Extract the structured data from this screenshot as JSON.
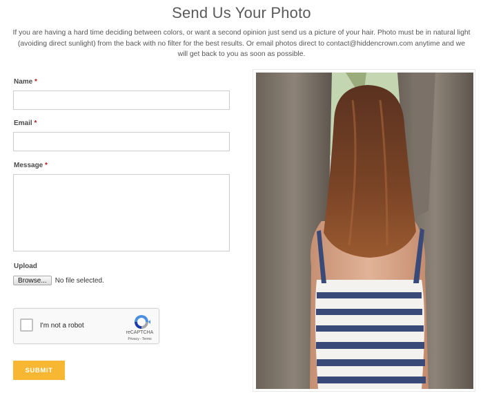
{
  "page": {
    "title": "Send Us Your Photo",
    "intro": "If you are having a hard time deciding between colors, or want a second opinion just send us a picture of your hair. Photo must be in natural light (avoiding direct sunlight) from the back with no filter for the best results. Or email photos direct to contact@hiddencrown.com anytime and we will get back to you as soon as possible."
  },
  "form": {
    "name_label": "Name",
    "email_label": "Email",
    "message_label": "Message",
    "required_mark": "*",
    "name_value": "",
    "email_value": "",
    "message_value": "",
    "upload_label": "Upload",
    "browse_label": "Browse...",
    "file_status": "No file selected.",
    "submit_label": "SUBMIT"
  },
  "captcha": {
    "label": "I'm not a robot",
    "brand": "reCAPTCHA",
    "links": "Privacy - Terms"
  },
  "colors": {
    "accent": "#f7b733",
    "required": "#b01919",
    "title": "#5a5a5a"
  },
  "icons": {
    "captcha": "recaptcha-logo-icon"
  }
}
